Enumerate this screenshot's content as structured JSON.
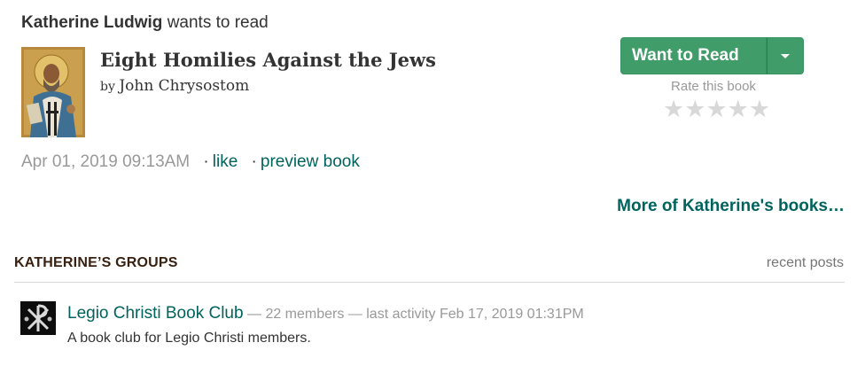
{
  "update": {
    "actor": "Katherine Ludwig",
    "action": "wants to read"
  },
  "book": {
    "title": "Eight Homilies Against the Jews",
    "by": "by",
    "author": "John Chrysostom",
    "cover_icon": "saint-icon-cover"
  },
  "shelf_button": {
    "label": "Want to Read",
    "dropdown_icon": "caret-down-icon"
  },
  "rating": {
    "label": "Rate this book",
    "stars": [
      "★",
      "★",
      "★",
      "★",
      "★"
    ],
    "value": 0,
    "max": 5
  },
  "meta": {
    "timestamp": "Apr 01, 2019 09:13AM",
    "separator": "·",
    "like_label": "like",
    "preview_label": "preview book"
  },
  "more_books": {
    "label": "More of Katherine's books…"
  },
  "groups": {
    "heading": "KATHERINE’S GROUPS",
    "recent_posts_label": "recent posts",
    "items": [
      {
        "name": "Legio Christi Book Club",
        "details": " — 22 members — last activity Feb 17, 2019 01:31PM",
        "description": "A book club for Legio Christi members.",
        "icon": "chi-rho-icon"
      }
    ]
  },
  "colors": {
    "accent_green": "#409d69",
    "link_teal": "#00635d",
    "muted_gray": "#999999",
    "heading_brown": "#382110"
  }
}
